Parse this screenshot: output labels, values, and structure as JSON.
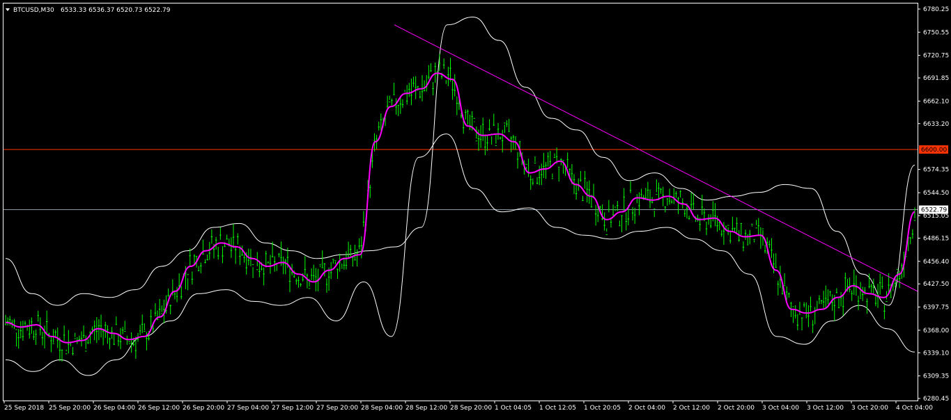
{
  "header": {
    "symbol": "BTCUSD,M30",
    "ohlc": "6533.33 6536.37 6520.73 6522.79"
  },
  "colors": {
    "background": "#000000",
    "candle": "#00ff00",
    "bands": "#ffffff",
    "ma": "#ff00ff",
    "trendline": "#ff00ff",
    "resistance": "#ff3300",
    "current_price_line": "#8c9aa8",
    "axis": "#ffffff"
  },
  "icons": {
    "menu": "triangle-down-icon"
  },
  "chart_data": {
    "type": "candlestick",
    "title": "BTCUSD,M30",
    "ylim": [
      6280.45,
      6780.25
    ],
    "y_ticks": [
      "6780.25",
      "6750.55",
      "6720.75",
      "6691.85",
      "6662.10",
      "6633.20",
      "6600.00",
      "6574.35",
      "6544.50",
      "6522.79",
      "6515.05",
      "6486.15",
      "6456.40",
      "6427.50",
      "6397.75",
      "6368.00",
      "6339.10",
      "6309.35",
      "6280.45"
    ],
    "x_ticks": [
      "25 Sep 2018",
      "25 Sep 20:00",
      "26 Sep 04:00",
      "26 Sep 12:00",
      "26 Sep 20:00",
      "27 Sep 04:00",
      "27 Sep 12:00",
      "27 Sep 20:00",
      "28 Sep 04:00",
      "28 Sep 12:00",
      "28 Sep 20:00",
      "1 Oct 04:05",
      "1 Oct 12:05",
      "1 Oct 20:05",
      "2 Oct 04:00",
      "2 Oct 12:00",
      "2 Oct 20:00",
      "3 Oct 04:00",
      "3 Oct 12:00",
      "3 Oct 20:00",
      "4 Oct 04:00"
    ],
    "horizontal_lines": [
      {
        "name": "resistance",
        "price": 6600.0,
        "label": "6600.00"
      },
      {
        "name": "current-price",
        "price": 6522.79,
        "label": "6522.79"
      }
    ],
    "trendline": {
      "start": {
        "x": "28 Sep 08:00",
        "y": 6760
      },
      "end": {
        "x": "4 Oct 04:00",
        "y": 6418
      }
    },
    "series": [
      {
        "name": "ma",
        "y": [
          6378,
          6372,
          6375,
          6360,
          6352,
          6355,
          6370,
          6364,
          6356,
          6360,
          6385,
          6418,
          6450,
          6470,
          6480,
          6475,
          6460,
          6450,
          6455,
          6440,
          6430,
          6445,
          6460,
          6465,
          6610,
          6655,
          6672,
          6678,
          6698,
          6690,
          6630,
          6618,
          6620,
          6610,
          6570,
          6575,
          6585,
          6555,
          6540,
          6510,
          6520,
          6538,
          6535,
          6540,
          6530,
          6510,
          6512,
          6495,
          6488,
          6490,
          6445,
          6395,
          6390,
          6395,
          6410,
          6425,
          6415,
          6410,
          6440,
          6520
        ]
      },
      {
        "name": "upper-band",
        "y": [
          6460,
          6415,
          6400,
          6415,
          6410,
          6420,
          6450,
          6470,
          6500,
          6505,
          6480,
          6470,
          6460,
          6465,
          6470,
          6475,
          6500,
          6760,
          6770,
          6740,
          6680,
          6640,
          6625,
          6590,
          6560,
          6570,
          6550,
          6535,
          6540,
          6545,
          6555,
          6550,
          6495,
          6440,
          6400,
          6580
        ]
      },
      {
        "name": "lower-band",
        "y": [
          6330,
          6315,
          6330,
          6310,
          6330,
          6360,
          6380,
          6415,
          6420,
          6405,
          6400,
          6410,
          6380,
          6430,
          6360,
          6590,
          6620,
          6550,
          6520,
          6525,
          6500,
          6490,
          6485,
          6495,
          6500,
          6485,
          6470,
          6440,
          6360,
          6350,
          6380,
          6400,
          6370,
          6340
        ]
      }
    ]
  }
}
